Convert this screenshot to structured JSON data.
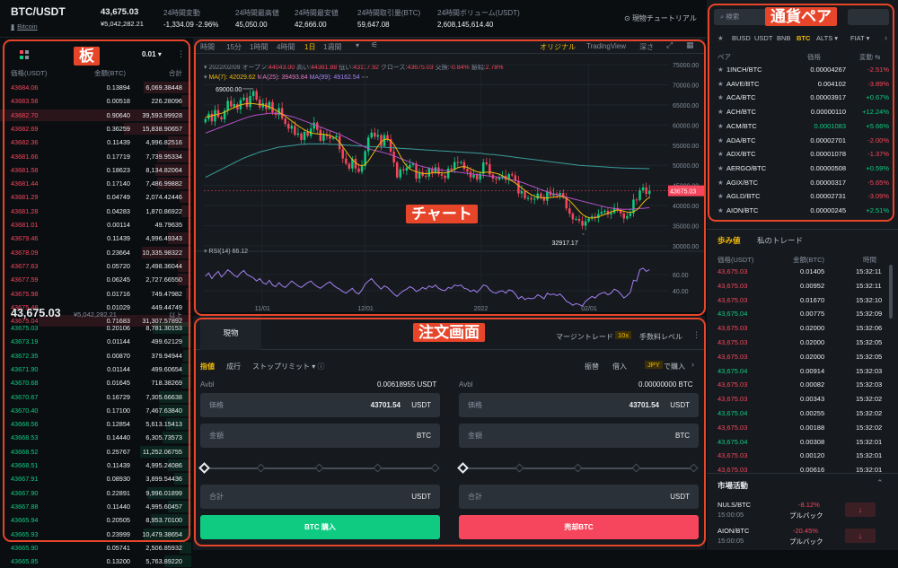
{
  "header": {
    "pair": "BTC/USDT",
    "sublink": "Bitcoin",
    "price": "43,675.03",
    "price_fiat": "¥5,042,282.21",
    "stats": [
      {
        "label": "24時間変動",
        "value": "-1,334.09 -2.96%",
        "color": "down"
      },
      {
        "label": "24時間最高値",
        "value": "45,050.00",
        "color": "none"
      },
      {
        "label": "24時間最安値",
        "value": "42,666.00",
        "color": "none"
      },
      {
        "label": "24時間取引量(BTC)",
        "value": "59,647.08",
        "color": "none"
      },
      {
        "label": "24時間ボリューム(USDT)",
        "value": "2,608,145,614.40",
        "color": "none"
      }
    ],
    "tutorial": "現物チュートリアル"
  },
  "orderbook": {
    "decimals": "0.01",
    "col_price": "価格(USDT)",
    "col_amount": "金額(BTC)",
    "col_total": "合計",
    "asks": [
      [
        "43684.06",
        "0.13894",
        "6,069.38448",
        0.25
      ],
      [
        "43683.58",
        "0.00518",
        "226.28096",
        0.05
      ],
      [
        "43682.70",
        "0.90640",
        "39,593.99928",
        1.0
      ],
      [
        "43682.69",
        "0.36259",
        "15,838.90657",
        0.35
      ],
      [
        "43682.36",
        "0.11439",
        "4,996.82516",
        0.12
      ],
      [
        "43681.66",
        "0.17719",
        "7,739.95334",
        0.18
      ],
      [
        "43681.58",
        "0.18623",
        "8,134.82064",
        0.19
      ],
      [
        "43681.44",
        "0.17140",
        "7,486.99882",
        0.18
      ],
      [
        "43681.29",
        "0.04749",
        "2,074.42446",
        0.06
      ],
      [
        "43681.28",
        "0.04283",
        "1,870.86922",
        0.05
      ],
      [
        "43681.01",
        "0.00114",
        "49.79635",
        0.02
      ],
      [
        "43679.46",
        "0.11439",
        "4,996.49343",
        0.12
      ],
      [
        "43678.09",
        "0.23664",
        "10,335.98322",
        0.26
      ],
      [
        "43677.63",
        "0.05720",
        "2,498.36044",
        0.07
      ],
      [
        "43677.59",
        "0.06245",
        "2,727.66550",
        0.07
      ],
      [
        "43675.98",
        "0.01716",
        "749.47982",
        0.03
      ],
      [
        "43675.48",
        "0.01029",
        "449.44749",
        0.02
      ],
      [
        "43675.04",
        "0.71683",
        "31,307.57892",
        0.8
      ]
    ],
    "mid_price": "43,675.03",
    "mid_fiat": "¥5,042,282.21",
    "mid_more": "以上",
    "bids": [
      [
        "43675.03",
        "0.20106",
        "8,781.30153",
        0.2
      ],
      [
        "43673.19",
        "0.01144",
        "499.62129",
        0.05
      ],
      [
        "43672.35",
        "0.00870",
        "379.94944",
        0.04
      ],
      [
        "43671.90",
        "0.01144",
        "499.60654",
        0.05
      ],
      [
        "43670.68",
        "0.01645",
        "718.38269",
        0.05
      ],
      [
        "43670.67",
        "0.16729",
        "7,305.66638",
        0.17
      ],
      [
        "43670.40",
        "0.17100",
        "7,467.63840",
        0.17
      ],
      [
        "43668.56",
        "0.12854",
        "5,613.15413",
        0.13
      ],
      [
        "43668.53",
        "0.14440",
        "6,305.73573",
        0.15
      ],
      [
        "43668.52",
        "0.25767",
        "11,252.06755",
        0.27
      ],
      [
        "43668.51",
        "0.11439",
        "4,995.24086",
        0.12
      ],
      [
        "43667.91",
        "0.08930",
        "3,899.54436",
        0.09
      ],
      [
        "43667.90",
        "0.22891",
        "9,996.01899",
        0.23
      ],
      [
        "43667.88",
        "0.11440",
        "4,995.60457",
        0.12
      ],
      [
        "43665.94",
        "0.20505",
        "8,953.70100",
        0.21
      ],
      [
        "43665.93",
        "0.23999",
        "10,479.38654",
        0.25
      ],
      [
        "43665.90",
        "0.05741",
        "2,506.85932",
        0.06
      ],
      [
        "43665.85",
        "0.13200",
        "5,763.89220",
        0.14
      ]
    ]
  },
  "chart_toolbar": {
    "intervals": [
      "時間",
      "15分",
      "1時間",
      "4時間",
      "1日",
      "1週間"
    ],
    "active": "1日",
    "views": [
      "オリジナル",
      "TradingView",
      "深さ"
    ]
  },
  "chart_info": {
    "date": "2022/02/09",
    "open_label": "オープン:",
    "open": "44043.00",
    "high_label": "高い:",
    "high": "44361.88",
    "low_label": "低い:",
    "low": "43117.92",
    "close_label": "クローズ:",
    "close": "43675.03",
    "change_label": "交換:",
    "change": "-0.84%",
    "amp_label": "振幅:",
    "amp": "2.78%",
    "ma7": "MA(7): 42029.62",
    "ma25": "MA(25): 39493.84",
    "ma99": "MA(99): 49162.54",
    "rsi": "RSI(14) 66.12"
  },
  "chart_data": {
    "type": "candlestick",
    "price_axis": [
      75000,
      70000,
      65000,
      60000,
      55000,
      50000,
      45000,
      40000,
      35000,
      30000
    ],
    "x_ticks": [
      "11/01",
      "12/01",
      "2022",
      "02/01"
    ],
    "rsi_axis": [
      60,
      40
    ],
    "last_price": "43675.03",
    "high_label": "69000.00",
    "low_label": "32917.17",
    "closes": [
      61500,
      62800,
      60900,
      63700,
      62000,
      61400,
      63600,
      66000,
      64600,
      65200,
      63900,
      66200,
      66800,
      64500,
      67200,
      68400,
      66300,
      64400,
      65400,
      64000,
      65700,
      63100,
      62500,
      64200,
      61600,
      60300,
      59100,
      59800,
      57600,
      57900,
      56300,
      58300,
      57300,
      59100,
      60600,
      58800,
      56100,
      57700,
      57200,
      56600,
      56900,
      57300,
      54000,
      51700,
      50400,
      49200,
      51600,
      49200,
      48400,
      49800,
      53500,
      56900,
      58100,
      57100,
      57500,
      54800,
      57500,
      56500,
      53400,
      50700,
      47000,
      49000,
      48700,
      49400,
      50100,
      50400,
      46700,
      48300,
      47400,
      47200,
      49200,
      48100,
      49500,
      47800,
      47400,
      46800,
      49200,
      48900,
      50800,
      50600,
      50800,
      49100,
      48400,
      47000,
      47600,
      46500,
      47900,
      50700,
      50300,
      47700,
      46700,
      46500,
      47000,
      47400,
      46400,
      47800,
      47500,
      46200,
      43000,
      43600,
      41800,
      41900,
      41500,
      41700,
      43000,
      42100,
      41200,
      43500,
      42500,
      43000,
      42600,
      43100,
      42000,
      39300,
      38000,
      36600,
      36700,
      36200,
      35000,
      36100,
      36800,
      37300,
      36900,
      37900,
      38400,
      38700,
      37800,
      38200,
      39400,
      38900,
      38100,
      36800,
      37400,
      38100,
      41500,
      41400,
      43800,
      44500,
      42900,
      43675
    ],
    "ma7": [
      62000,
      62100,
      62300,
      62500,
      62700,
      62900,
      63200,
      63600,
      64000,
      64400,
      64700,
      65000,
      65200,
      65300,
      65400,
      65300,
      65200,
      65100,
      65000,
      64800,
      64500,
      64100,
      63700,
      63200,
      62700,
      62200,
      61600,
      61000,
      60400,
      59800,
      59300,
      58800,
      58400,
      58100,
      57900,
      57800,
      57800,
      57700,
      57600,
      57400,
      57100,
      56500,
      55700,
      54600,
      53500,
      52400,
      51400,
      50600,
      50100,
      49900,
      50200,
      51100,
      52300,
      53500,
      54800,
      55800,
      56400,
      56500,
      56100,
      55200,
      53800,
      52300,
      50900,
      49800,
      49100,
      48700,
      48400,
      48200,
      48000,
      47900,
      48000,
      48100,
      48200,
      48200,
      48100,
      48100,
      48300,
      48600,
      49000,
      49400,
      49600,
      49700,
      49500,
      49100,
      48700,
      48400,
      48200,
      48200,
      48300,
      48300,
      48200,
      48000,
      47800,
      47400,
      46900,
      46500,
      46100,
      45600,
      45000,
      44400,
      43800,
      43200,
      42700,
      42300,
      42100,
      42000,
      41900,
      41900,
      42000,
      42100,
      42200,
      42300,
      42200,
      41800,
      41200,
      40400,
      39500,
      38600,
      37800,
      37300,
      37000,
      36900,
      37000,
      37200,
      37500,
      37800,
      38100,
      38400,
      38700,
      38900,
      38800,
      38600,
      38400,
      38300,
      38500,
      38900,
      39700,
      40700,
      41500,
      42029
    ],
    "ma25": [
      58000,
      58300,
      58600,
      58900,
      59200,
      59500,
      59800,
      60100,
      60400,
      60700,
      61000,
      61300,
      61600,
      61900,
      62100,
      62300,
      62500,
      62600,
      62700,
      62800,
      62900,
      62900,
      62900,
      62800,
      62700,
      62500,
      62300,
      62100,
      61900,
      61600,
      61300,
      61000,
      60700,
      60400,
      60100,
      59800,
      59500,
      59200,
      58900,
      58600,
      58300,
      58000,
      57700,
      57300,
      56900,
      56500,
      56100,
      55700,
      55300,
      54900,
      54500,
      54200,
      53900,
      53700,
      53500,
      53300,
      53100,
      52900,
      52600,
      52300,
      52000,
      51700,
      51400,
      51100,
      50800,
      50500,
      50200,
      49900,
      49700,
      49500,
      49300,
      49100,
      49000,
      48900,
      48800,
      48700,
      48600,
      48500,
      48400,
      48300,
      48200,
      48100,
      48000,
      47900,
      47800,
      47700,
      47600,
      47500,
      47400,
      47300,
      47200,
      47100,
      47000,
      46900,
      46800,
      46600,
      46400,
      46200,
      46000,
      45800,
      45500,
      45200,
      44900,
      44600,
      44300,
      44000,
      43700,
      43400,
      43100,
      42900,
      42700,
      42500,
      42300,
      42100,
      41900,
      41700,
      41500,
      41300,
      41100,
      40900,
      40700,
      40500,
      40300,
      40100,
      39900,
      39700,
      39500,
      39400,
      39300,
      39200,
      39100,
      39100,
      39100,
      39100,
      39200,
      39200,
      39300,
      39300,
      39400,
      39494
    ],
    "ma99": [
      47000,
      47400,
      47800,
      48200,
      48600,
      49000,
      49400,
      49800,
      50200,
      50600,
      51000,
      51400,
      51800,
      52100,
      52400,
      52700,
      53000,
      53300,
      53500,
      53700,
      53900,
      54100,
      54300,
      54500,
      54600,
      54700,
      54800,
      54900,
      55000,
      55100,
      55200,
      55200,
      55300,
      55300,
      55300,
      55300,
      55300,
      55300,
      55300,
      55200,
      55200,
      55200,
      55100,
      55100,
      55000,
      55000,
      54900,
      54900,
      54800,
      54800,
      54700,
      54700,
      54600,
      54600,
      54600,
      54500,
      54500,
      54400,
      54400,
      54300,
      54300,
      54200,
      54200,
      54100,
      54100,
      54000,
      54000,
      53900,
      53900,
      53800,
      53800,
      53700,
      53700,
      53600,
      53600,
      53500,
      53500,
      53400,
      53400,
      53300,
      53300,
      53200,
      53200,
      53100,
      53100,
      53000,
      53000,
      52900,
      52800,
      52700,
      52700,
      52600,
      52500,
      52400,
      52300,
      52200,
      52100,
      52000,
      51900,
      51800,
      51700,
      51600,
      51500,
      51400,
      51300,
      51200,
      51100,
      51000,
      50900,
      50800,
      50700,
      50600,
      50500,
      50400,
      50300,
      50200,
      50100,
      50000,
      49950,
      49900,
      49850,
      49800,
      49750,
      49700,
      49650,
      49600,
      49550,
      49500,
      49450,
      49400,
      49360,
      49320,
      49300,
      49280,
      49260,
      49240,
      49220,
      49200,
      49180,
      49163
    ],
    "rsi": [
      58,
      62,
      55,
      60,
      64,
      57,
      61,
      66,
      63,
      59,
      57,
      62,
      65,
      60,
      58,
      56,
      52,
      55,
      50,
      48,
      53,
      47,
      45,
      50,
      46,
      44,
      48,
      52,
      49,
      46,
      44,
      47,
      50,
      52,
      48,
      45,
      43,
      46,
      49,
      51,
      47,
      44,
      42,
      39,
      37,
      40,
      43,
      38,
      36,
      41,
      48,
      52,
      55,
      50,
      46,
      42,
      46,
      44,
      40,
      36,
      33,
      37,
      40,
      42,
      45,
      43,
      39,
      41,
      44,
      42,
      46,
      44,
      47,
      43,
      41,
      40,
      44,
      43,
      47,
      46,
      47,
      43,
      42,
      39,
      41,
      38,
      42,
      47,
      46,
      41,
      38,
      37,
      39,
      40,
      37,
      41,
      40,
      36,
      30,
      33,
      29,
      31,
      30,
      31,
      35,
      33,
      30,
      37,
      35,
      36,
      34,
      36,
      32,
      27,
      25,
      22,
      24,
      23,
      21,
      27,
      30,
      33,
      31,
      35,
      37,
      38,
      35,
      37,
      42,
      40,
      36,
      31,
      34,
      38,
      53,
      52,
      66,
      68,
      64,
      66
    ]
  },
  "order_panel": {
    "tab": "現物",
    "margin": "マージントレード",
    "leverage": "10x",
    "fee": "手数料レベル",
    "order_types": [
      "指値",
      "成行",
      "ストップリミット"
    ],
    "right_links": [
      "振替",
      "借入"
    ],
    "currency": "JPY",
    "buy_with": "で購入",
    "avbl_label": "Avbl",
    "buy": {
      "avbl": "0.00618955 USDT",
      "price_label": "価格",
      "price": "43701.54",
      "price_unit": "USDT",
      "amount_label": "金額",
      "amount_unit": "BTC",
      "total_label": "合計",
      "total_unit": "USDT",
      "button": "BTC 購入"
    },
    "sell": {
      "avbl": "0.00000000 BTC",
      "price_label": "価格",
      "price": "43701.54",
      "price_unit": "USDT",
      "amount_label": "金額",
      "amount_unit": "BTC",
      "total_label": "合計",
      "total_unit": "USDT",
      "button": "売却BTC"
    }
  },
  "pairs": {
    "search_placeholder": "検索",
    "tabs": [
      "BUSD",
      "USDT",
      "BNB",
      "BTC",
      "ALTS",
      "FIAT"
    ],
    "active_tab": "BTC",
    "col_pair": "ペア",
    "col_price": "価格",
    "col_change": "変動",
    "rows": [
      [
        "1INCH/BTC",
        "0.00004267",
        "-2.51%",
        "down"
      ],
      [
        "AAVE/BTC",
        "0.004102",
        "-3.89%",
        "down"
      ],
      [
        "ACA/BTC",
        "0.00003917",
        "+0.67%",
        "up"
      ],
      [
        "ACH/BTC",
        "0.00000110",
        "+12.24%",
        "up"
      ],
      [
        "ACM/BTC",
        "0.0001083",
        "+5.66%",
        "up"
      ],
      [
        "ADA/BTC",
        "0.00002701",
        "-2.00%",
        "down"
      ],
      [
        "ADX/BTC",
        "0.00001078",
        "-1.37%",
        "down"
      ],
      [
        "AERGO/BTC",
        "0.00000508",
        "+0.59%",
        "up"
      ],
      [
        "AGIX/BTC",
        "0.00000317",
        "-5.65%",
        "down"
      ],
      [
        "AGLD/BTC",
        "0.00002731",
        "-3.09%",
        "down"
      ],
      [
        "AION/BTC",
        "0.00000245",
        "+2.51%",
        "up"
      ]
    ]
  },
  "trades": {
    "tabs": [
      "歩み値",
      "私のトレード"
    ],
    "col_price": "価格(USDT)",
    "col_amount": "金額(BTC)",
    "col_time": "時間",
    "rows": [
      [
        "43,675.03",
        "0.01405",
        "15:32:11",
        "down"
      ],
      [
        "43,675.03",
        "0.00952",
        "15:32:11",
        "down"
      ],
      [
        "43,675.03",
        "0.01670",
        "15:32:10",
        "down"
      ],
      [
        "43,675.04",
        "0.00775",
        "15:32:09",
        "up"
      ],
      [
        "43,675.03",
        "0.02000",
        "15:32:06",
        "down"
      ],
      [
        "43,675.03",
        "0.02000",
        "15:32:05",
        "down"
      ],
      [
        "43,675.03",
        "0.02000",
        "15:32:05",
        "down"
      ],
      [
        "43,675.04",
        "0.00914",
        "15:32:03",
        "up"
      ],
      [
        "43,675.03",
        "0.00082",
        "15:32:03",
        "down"
      ],
      [
        "43,675.03",
        "0.00343",
        "15:32:02",
        "down"
      ],
      [
        "43,675.04",
        "0.00255",
        "15:32:02",
        "up"
      ],
      [
        "43,675.03",
        "0.00188",
        "15:32:02",
        "down"
      ],
      [
        "43,675.04",
        "0.00308",
        "15:32:01",
        "up"
      ],
      [
        "43,675.03",
        "0.00120",
        "15:32:01",
        "down"
      ],
      [
        "43,675.03",
        "0.00616",
        "15:32:01",
        "down"
      ]
    ]
  },
  "market": {
    "title": "市場活動",
    "rows": [
      {
        "pair": "NULS/BTC",
        "time": "15:00:05",
        "change": "-8.12%",
        "label": "プルバック"
      },
      {
        "pair": "AION/BTC",
        "time": "15:00:05",
        "change": "-20.45%",
        "label": "プルバック"
      }
    ]
  },
  "annotations": {
    "book": "板",
    "chart": "チャート",
    "order": "注文画面",
    "pairs": "通貨ペア"
  },
  "colors": {
    "up": "#0ecb81",
    "down": "#f6465d",
    "accent": "#f0b90b",
    "annotation": "#e7452a"
  }
}
